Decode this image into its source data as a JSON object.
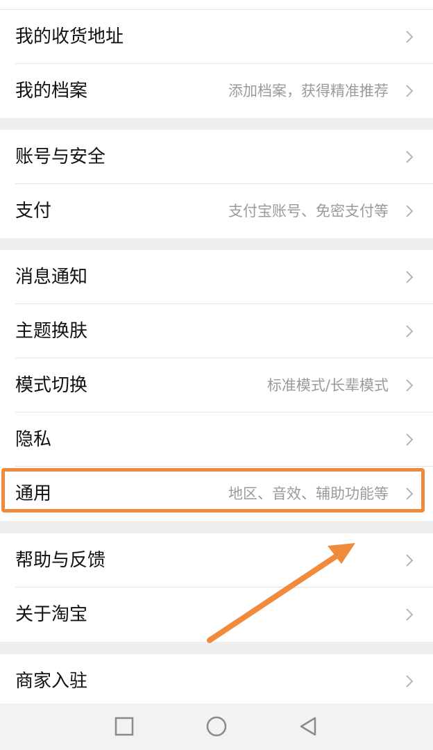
{
  "rows": [
    {
      "label": "我的收货地址",
      "hint": ""
    },
    {
      "label": "我的档案",
      "hint": "添加档案，获得精准推荐"
    },
    {
      "label": "账号与安全",
      "hint": ""
    },
    {
      "label": "支付",
      "hint": "支付宝账号、免密支付等"
    },
    {
      "label": "消息通知",
      "hint": ""
    },
    {
      "label": "主题换肤",
      "hint": ""
    },
    {
      "label": "模式切换",
      "hint": "标准模式/长辈模式"
    },
    {
      "label": "隐私",
      "hint": ""
    },
    {
      "label": "通用",
      "hint": "地区、音效、辅助功能等"
    },
    {
      "label": "帮助与反馈",
      "hint": ""
    },
    {
      "label": "关于淘宝",
      "hint": ""
    },
    {
      "label": "商家入驻",
      "hint": ""
    }
  ],
  "icons": {
    "chevron": "chevron-right-icon",
    "nav_recent": "square-icon",
    "nav_home": "circle-icon",
    "nav_back": "triangle-back-icon"
  },
  "colors": {
    "highlight": "#f08a3c",
    "hint_text": "#9a9a9a",
    "background": "#efefef"
  }
}
